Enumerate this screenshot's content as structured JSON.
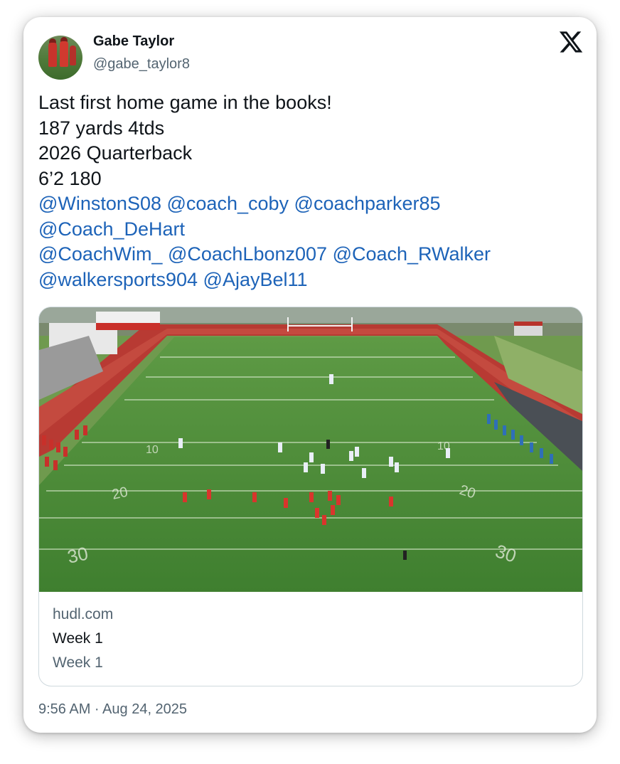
{
  "user": {
    "name": "Gabe Taylor",
    "handle": "@gabe_taylor8"
  },
  "brand": {
    "logo": "x-logo-icon"
  },
  "tweet": {
    "lines": [
      "Last first home game in the books!",
      "187 yards 4tds",
      "2026 Quarterback",
      "6’2 180"
    ],
    "mention_lines": [
      [
        "@WinstonS08",
        "@coach_coby",
        "@coachparker85"
      ],
      [
        "@Coach_DeHart"
      ],
      [
        "@CoachWim_",
        "@CoachLbonz007",
        "@Coach_RWalker"
      ],
      [
        "@walkersports904",
        "@AjayBel11"
      ]
    ]
  },
  "link_card": {
    "domain": "hudl.com",
    "title": "Week 1",
    "description": "Week 1",
    "image": "aerial-football-field-photo",
    "field_numbers": [
      "10",
      "20",
      "30"
    ]
  },
  "timestamp": "9:56 AM · Aug 24, 2025",
  "colors": {
    "mention": "#1d63b8",
    "text": "#0f1419",
    "secondary": "#536471",
    "turf": "#4f8f3a",
    "track": "#b83a33"
  }
}
